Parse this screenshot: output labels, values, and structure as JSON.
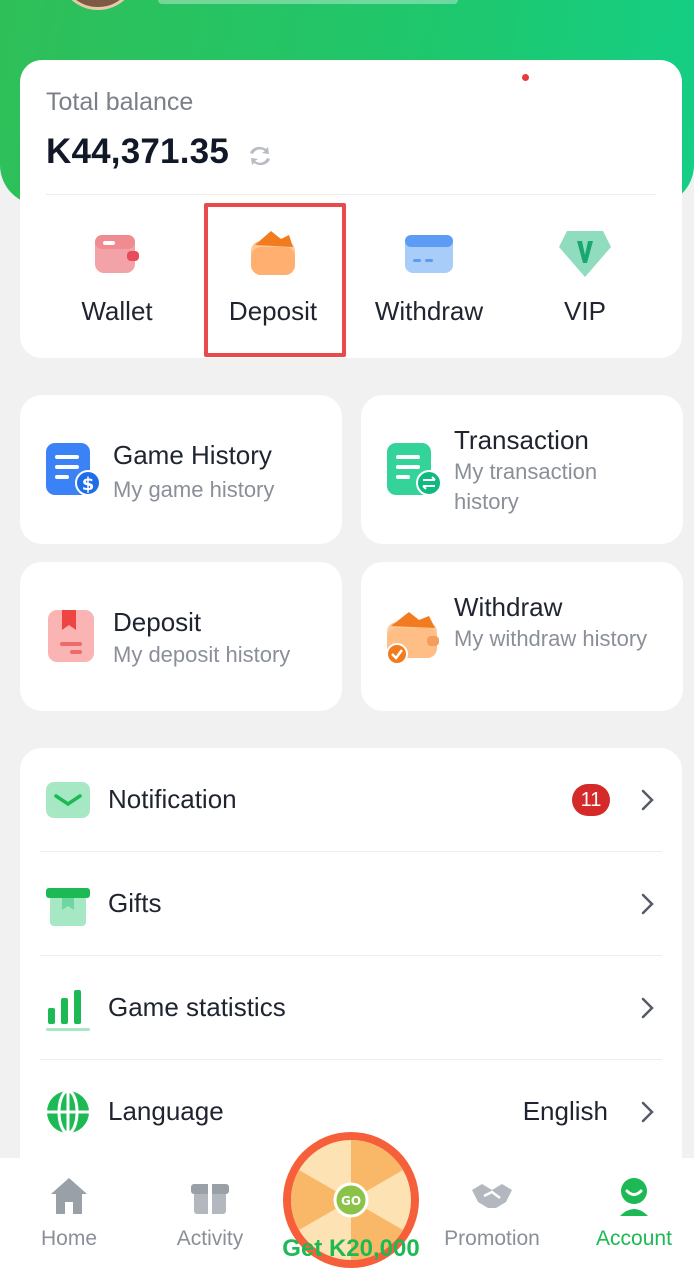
{
  "balance": {
    "label": "Total balance",
    "amount": "K44,371.35"
  },
  "quick_actions": [
    {
      "label": "Wallet",
      "icon": "wallet-icon"
    },
    {
      "label": "Deposit",
      "icon": "deposit-icon"
    },
    {
      "label": "Withdraw",
      "icon": "card-icon"
    },
    {
      "label": "VIP",
      "icon": "vip-icon"
    }
  ],
  "history_tiles": [
    {
      "title": "Game History",
      "subtitle": "My game history",
      "icon": "game-history-icon"
    },
    {
      "title": "Transaction",
      "subtitle": "My transaction history",
      "icon": "transaction-icon"
    },
    {
      "title": "Deposit",
      "subtitle": "My deposit history",
      "icon": "deposit-history-icon"
    },
    {
      "title": "Withdraw",
      "subtitle": "My withdraw history",
      "icon": "withdraw-history-icon"
    }
  ],
  "menu": {
    "notification": {
      "label": "Notification",
      "badge": "11"
    },
    "gifts": {
      "label": "Gifts"
    },
    "statistics": {
      "label": "Game statistics"
    },
    "language": {
      "label": "Language",
      "value": "English"
    }
  },
  "bottom_nav": {
    "home": "Home",
    "activity": "Activity",
    "wheel": "Get K20,000",
    "wheel_go": "GO",
    "promotion": "Promotion",
    "account": "Account"
  },
  "colors": {
    "brand_green": "#1db954",
    "highlight_red": "#e84b4b",
    "badge_red": "#d42a2a"
  }
}
